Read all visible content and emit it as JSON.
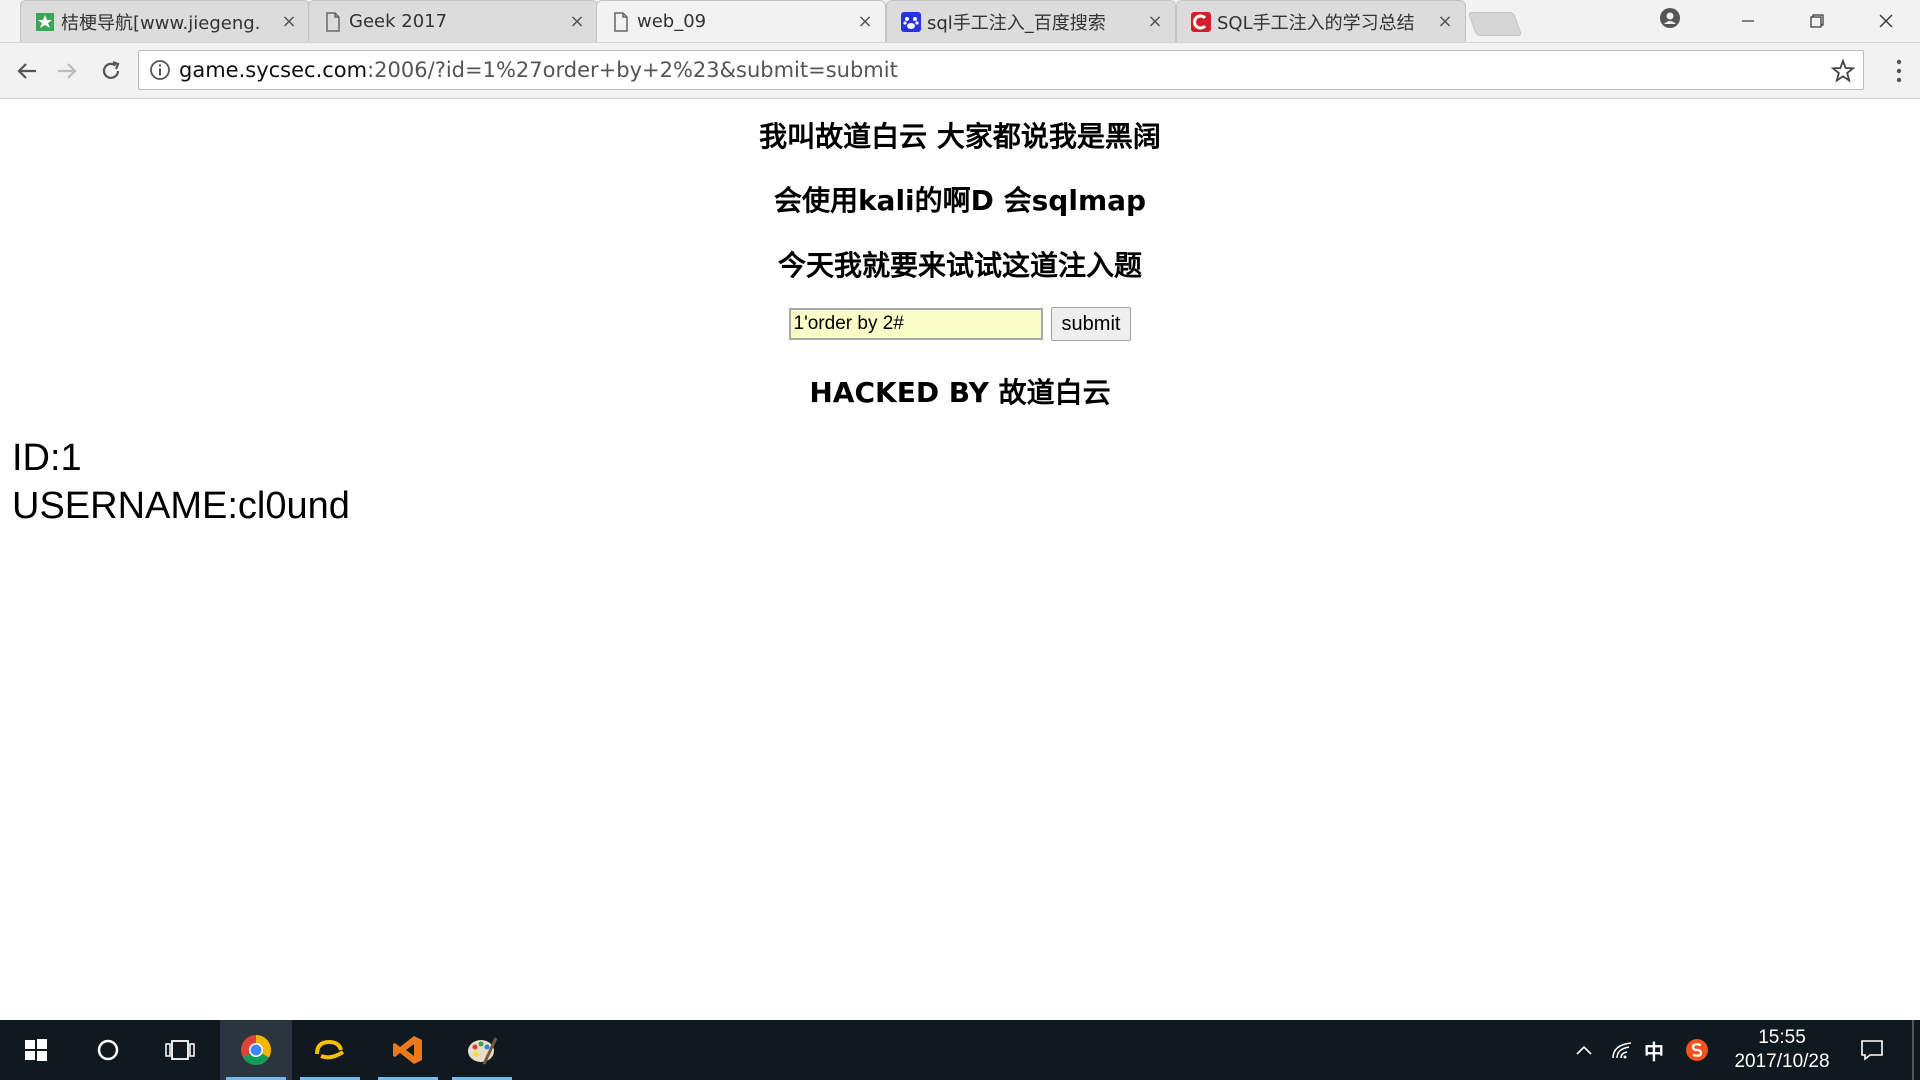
{
  "browser": {
    "tabs": [
      {
        "title": "桔梗导航[www.jiegeng.",
        "favicon": "jiegeng-favicon",
        "active": false
      },
      {
        "title": "Geek 2017",
        "favicon": "page-icon",
        "active": false
      },
      {
        "title": "web_09",
        "favicon": "page-icon",
        "active": true
      },
      {
        "title": "sql手工注入_百度搜索",
        "favicon": "baidu-paw-icon",
        "active": false
      },
      {
        "title": "SQL手工注入的学习总结",
        "favicon": "csdn-icon",
        "active": false
      }
    ],
    "close_glyph": "×",
    "url_host": "game.sycsec.com",
    "url_rest": ":2006/?id=1%27order+by+2%23&submit=submit"
  },
  "page": {
    "heading1": "我叫故道白云 大家都说我是黑阔",
    "heading2": "会使用kali的啊D 会sqlmap",
    "heading3": "今天我就要来试试这道注入题",
    "input_value": "1'order by 2#",
    "submit_label": "submit",
    "hacked_heading": "HACKED BY 故道白云",
    "result_id": "ID:1",
    "result_username": "USERNAME:cl0und"
  },
  "taskbar": {
    "ime": "中",
    "time": "15:55",
    "date": "2017/10/28"
  },
  "colors": {
    "input_bg": "#fafdc7",
    "taskbar_bg": "#101820",
    "running_indicator": "#76b9ed"
  }
}
